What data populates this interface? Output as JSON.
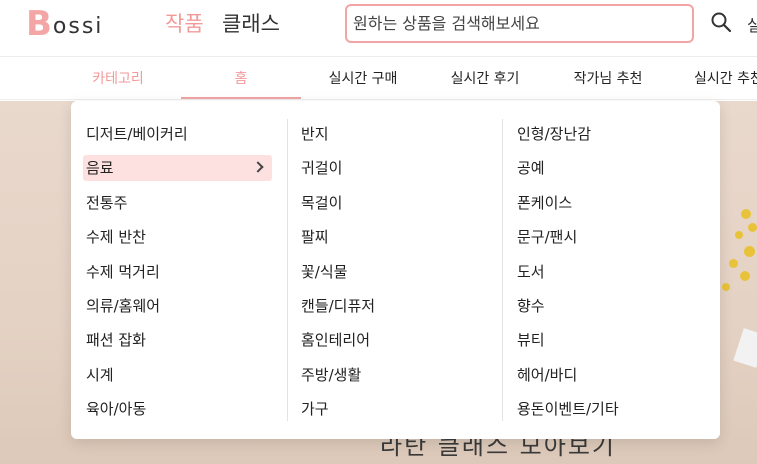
{
  "header": {
    "logo_first": "B",
    "logo_rest": "ossi",
    "tabs": {
      "works": "작품",
      "classes": "클래스"
    },
    "search_placeholder": "원하는 상품을 검색해보세요",
    "cut_label": "실"
  },
  "nav": {
    "items": [
      "카테고리",
      "홈",
      "실시간 구매",
      "실시간 후기",
      "작가님 추천",
      "실시간 추천"
    ]
  },
  "dropdown": {
    "columns": [
      [
        "디저트/베이커리",
        "음료",
        "전통주",
        "수제 반찬",
        "수제 먹거리",
        "의류/홈웨어",
        "패션 잡화",
        "시계",
        "육아/아동"
      ],
      [
        "반지",
        "귀걸이",
        "목걸이",
        "팔찌",
        "꽃/식물",
        "캔들/디퓨저",
        "홈인테리어",
        "주방/생활",
        "가구"
      ],
      [
        "인형/장난감",
        "공예",
        "폰케이스",
        "문구/팬시",
        "도서",
        "향수",
        "뷰티",
        "헤어/바디",
        "용돈이벤트/기타"
      ]
    ],
    "active_item": "음료"
  },
  "hero": {
    "title": "라탄 클래스 모아보기"
  },
  "colors": {
    "accent": "#f29a9a",
    "active_bg": "#fde0e0",
    "search_border": "#f3a5a5"
  },
  "icons": {
    "search": "search-icon",
    "chevron": "chevron-right-icon"
  }
}
